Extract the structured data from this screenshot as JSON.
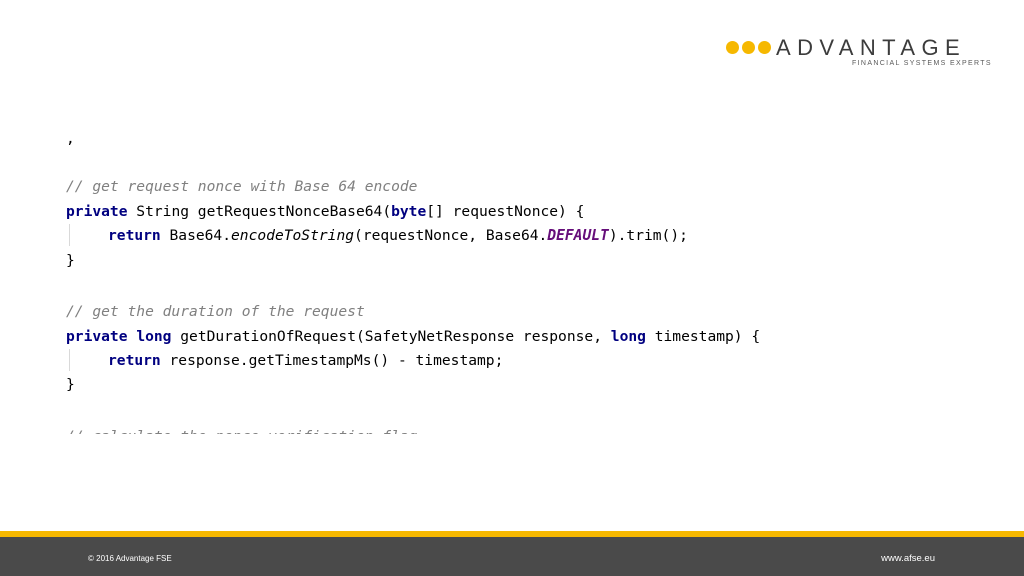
{
  "logo": {
    "word": "ADVANTAGE",
    "tagline": "FINANCIAL SYSTEMS EXPERTS",
    "dot_color": "#f6b800"
  },
  "code": {
    "top_fragment": ",",
    "comment1": "// get request nonce with Base 64 encode",
    "method1": {
      "kw_private": "private",
      "sig_rest": " String getRequestNonceBase64(",
      "kw_byte": "byte",
      "params_rest": "[] requestNonce) {",
      "kw_return": "return",
      "body_a": " Base64.",
      "call_italic": "encodeToString",
      "body_b": "(requestNonce, Base64.",
      "constant": "DEFAULT",
      "body_c": ").trim();",
      "close": "}"
    },
    "comment2": "// get the duration of the request",
    "method2": {
      "kw_private": "private",
      "kw_long": "long",
      "sig_rest": " getDurationOfRequest(SafetyNetResponse response, ",
      "kw_long2": "long",
      "params_rest": " timestamp) {",
      "kw_return": "return",
      "body": " response.getTimestampMs() - timestamp;",
      "close": "}"
    },
    "cut_fragment": "// calculate the nonce verification flag"
  },
  "footer": {
    "copyright": "© 2016 Advantage FSE",
    "url": "www.afse.eu",
    "stripe_color": "#f6b800",
    "bar_color": "#4a4a4a"
  }
}
